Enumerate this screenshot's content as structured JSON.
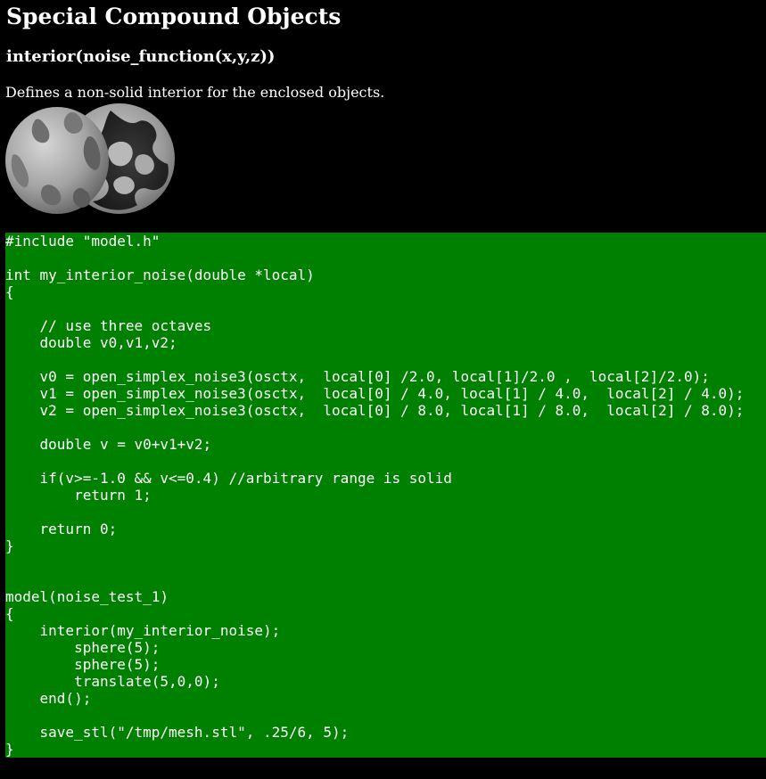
{
  "page": {
    "title": "Special Compound Objects",
    "subtitle": "interior(noise_function(x,y,z))",
    "description": "Defines a non-solid interior for the enclosed objects."
  },
  "colors": {
    "background": "#000000",
    "text": "#ffffff",
    "code_background": "#008000"
  },
  "code": {
    "listing": "#include \"model.h\"\n\nint my_interior_noise(double *local)\n{\n\n    // use three octaves\n    double v0,v1,v2;\n\n    v0 = open_simplex_noise3(osctx,  local[0] /2.0, local[1]/2.0 ,  local[2]/2.0);\n    v1 = open_simplex_noise3(osctx,  local[0] / 4.0, local[1] / 4.0,  local[2] / 4.0);\n    v2 = open_simplex_noise3(osctx,  local[0] / 8.0, local[1] / 8.0,  local[2] / 8.0);\n\n    double v = v0+v1+v2;\n\n    if(v>=-1.0 && v<=0.4) //arbitrary range is solid\n        return 1;\n\n    return 0;\n}\n\n\nmodel(noise_test_1)\n{\n    interior(my_interior_noise);\n        sphere(5);\n        sphere(5);\n        translate(5,0,0);\n    end();\n\n    save_stl(\"/tmp/mesh.stl\", .25/6, 5);\n}"
  }
}
